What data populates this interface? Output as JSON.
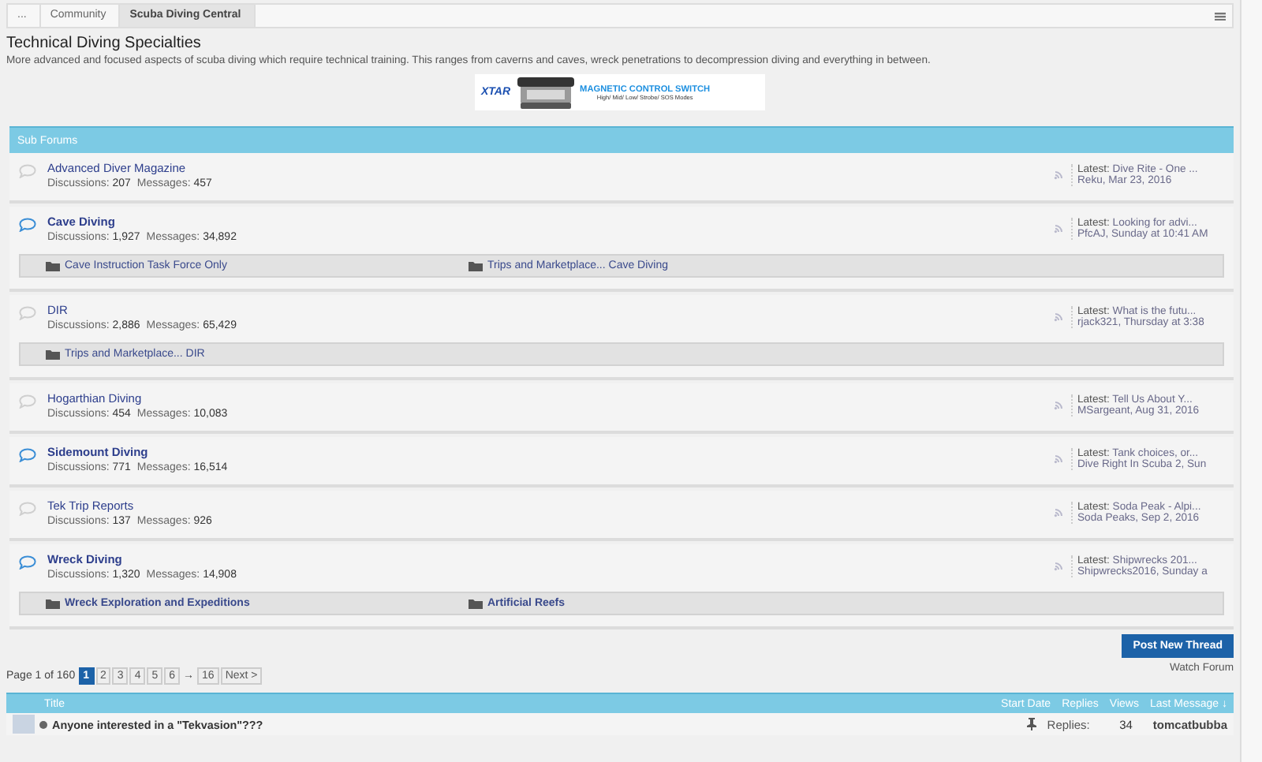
{
  "breadcrumb": [
    {
      "label": "...",
      "current": false
    },
    {
      "label": "Community",
      "current": false
    },
    {
      "label": "Scuba Diving Central",
      "current": true
    }
  ],
  "title": "Technical Diving Specialties",
  "description": "More advanced and focused aspects of scuba diving which require technical training. This ranges from caverns and caves, wreck penetrations to decompression diving and everything in between.",
  "banner": {
    "brand": "XTAR",
    "headline": "MAGNETIC CONTROL SWITCH",
    "tagline": "High/ Mid/ Low/ Strobe/ SOS Modes"
  },
  "subforums_header": "Sub Forums",
  "forums": [
    {
      "name": "Advanced Diver Magazine",
      "unread": false,
      "discussions_label": "Discussions:",
      "discussions": "207",
      "messages_label": "Messages:",
      "messages": "457",
      "latest_label": "Latest:",
      "latest_title": "Dive Rite - One ...",
      "latest_meta": "Reku, Mar 23, 2016"
    },
    {
      "name": "Cave Diving",
      "unread": true,
      "discussions_label": "Discussions:",
      "discussions": "1,927",
      "messages_label": "Messages:",
      "messages": "34,892",
      "latest_label": "Latest:",
      "latest_title": "Looking for advi...",
      "latest_meta": "PfcAJ, Sunday at 10:41 AM",
      "subforums": [
        {
          "label": "Cave Instruction Task Force Only",
          "unread": false
        },
        {
          "label": "Trips and Marketplace... Cave Diving",
          "unread": false
        }
      ]
    },
    {
      "name": "DIR",
      "unread": false,
      "discussions_label": "Discussions:",
      "discussions": "2,886",
      "messages_label": "Messages:",
      "messages": "65,429",
      "latest_label": "Latest:",
      "latest_title": "What is the futu...",
      "latest_meta": "rjack321, Thursday at 3:38",
      "subforums": [
        {
          "label": "Trips and Marketplace... DIR",
          "unread": false
        }
      ]
    },
    {
      "name": "Hogarthian Diving",
      "unread": false,
      "discussions_label": "Discussions:",
      "discussions": "454",
      "messages_label": "Messages:",
      "messages": "10,083",
      "latest_label": "Latest:",
      "latest_title": "Tell Us About Y...",
      "latest_meta": "MSargeant, Aug 31, 2016"
    },
    {
      "name": "Sidemount Diving",
      "unread": true,
      "discussions_label": "Discussions:",
      "discussions": "771",
      "messages_label": "Messages:",
      "messages": "16,514",
      "latest_label": "Latest:",
      "latest_title": "Tank choices, or...",
      "latest_meta": "Dive Right In Scuba 2, Sun"
    },
    {
      "name": "Tek Trip Reports",
      "unread": false,
      "discussions_label": "Discussions:",
      "discussions": "137",
      "messages_label": "Messages:",
      "messages": "926",
      "latest_label": "Latest:",
      "latest_title": "Soda Peak - Alpi...",
      "latest_meta": "Soda Peaks, Sep 2, 2016"
    },
    {
      "name": "Wreck Diving",
      "unread": true,
      "discussions_label": "Discussions:",
      "discussions": "1,320",
      "messages_label": "Messages:",
      "messages": "14,908",
      "latest_label": "Latest:",
      "latest_title": "Shipwrecks 201...",
      "latest_meta": "Shipwrecks2016, Sunday a",
      "subforums": [
        {
          "label": "Wreck Exploration and Expeditions",
          "unread": true
        },
        {
          "label": "Artificial Reefs",
          "unread": true
        }
      ]
    }
  ],
  "post_button": "Post New Thread",
  "watch_link": "Watch Forum",
  "pagination": {
    "summary": "Page 1 of 160",
    "pages": [
      {
        "label": "1",
        "selected": true
      },
      {
        "label": "2",
        "selected": false
      },
      {
        "label": "3",
        "selected": false
      },
      {
        "label": "4",
        "selected": false
      },
      {
        "label": "5",
        "selected": false
      },
      {
        "label": "6",
        "selected": false
      }
    ],
    "skip": "→",
    "last": "16",
    "next": "Next >"
  },
  "thread_columns": {
    "title": "Title",
    "start_date": "Start Date",
    "replies": "Replies",
    "views": "Views",
    "last_message": "Last Message ↓"
  },
  "threads": [
    {
      "title": "Anyone interested in a \"Tekvasion\"???",
      "sticky": true,
      "replies_label": "Replies:",
      "replies": "34",
      "last_user": "tomcatbubba"
    }
  ]
}
